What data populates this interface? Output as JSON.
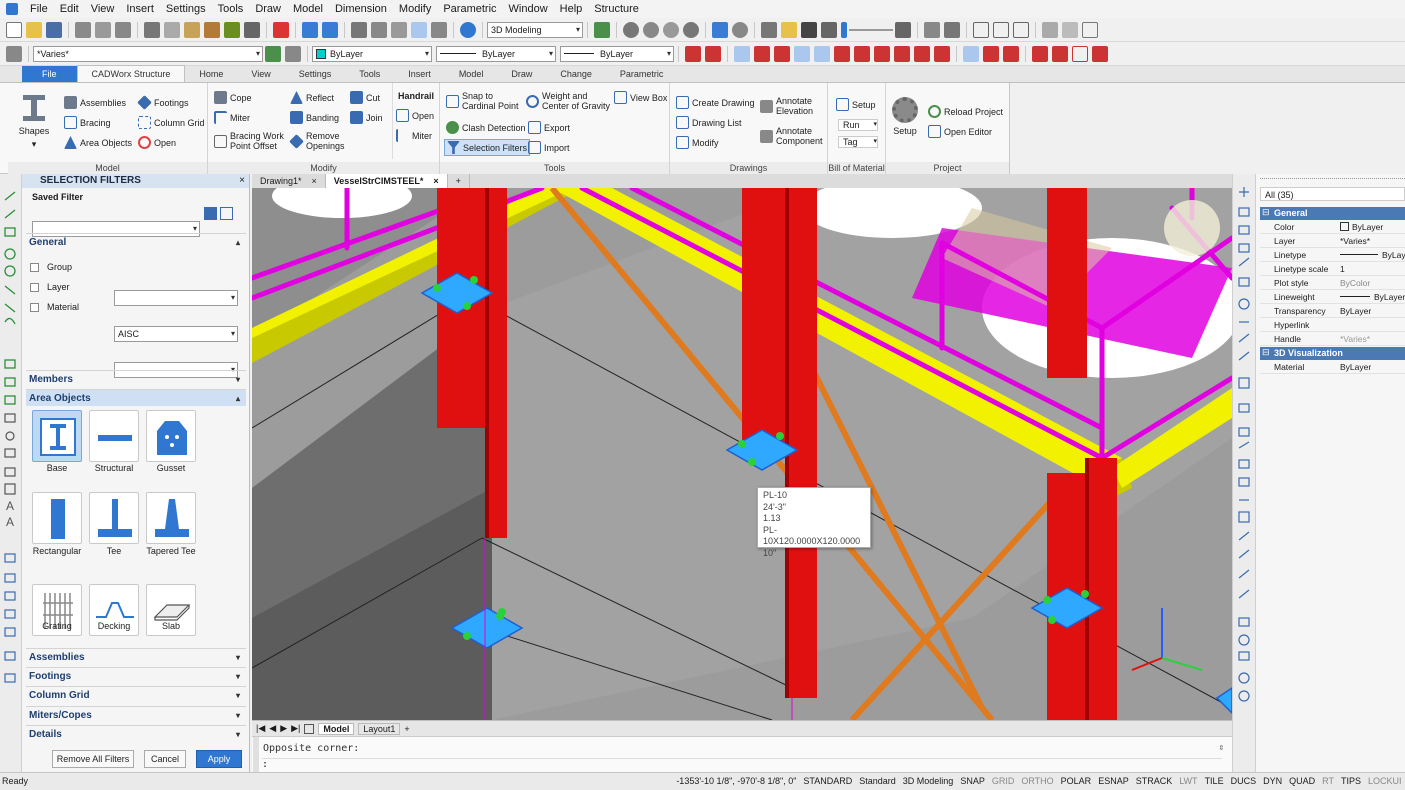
{
  "menu": [
    "File",
    "Edit",
    "View",
    "Insert",
    "Settings",
    "Tools",
    "Draw",
    "Model",
    "Dimension",
    "Modify",
    "Parametric",
    "Window",
    "Help",
    "Structure"
  ],
  "toolbar": {
    "workspace": "3D Modeling",
    "layer_value": "*Varies*",
    "color": "ByLayer",
    "linetype": "ByLayer",
    "lineweight": "ByLayer"
  },
  "ribbon_tabs": [
    "File",
    "CADWorx Structure",
    "Home",
    "View",
    "Settings",
    "Tools",
    "Insert",
    "Model",
    "Draw",
    "Change",
    "Parametric"
  ],
  "ribbon": {
    "model": {
      "label": "Model",
      "shapes": "Shapes",
      "assemblies": "Assemblies",
      "footings": "Footings",
      "bracing": "Bracing",
      "column_grid": "Column Grid",
      "area_objects": "Area Objects",
      "open": "Open"
    },
    "modify": {
      "label": "Modify",
      "cope": "Cope",
      "reflect": "Reflect",
      "cut": "Cut",
      "miter": "Miter",
      "banding": "Banding",
      "join": "Join",
      "bracing_work_point_offset": "Bracing Work Point Offset",
      "remove_openings": "Remove Openings",
      "handrail": "Handrail",
      "handrail_open": "Open",
      "handrail_miter": "Miter"
    },
    "tools": {
      "label": "Tools",
      "snap_cardinal": "Snap to Cardinal Point",
      "weight_cog": "Weight and Center of Gravity",
      "view_box": "View Box",
      "clash_detection": "Clash Detection",
      "export": "Export",
      "selection_filters": "Selection Filters",
      "import": "Import"
    },
    "drawings": {
      "label": "Drawings",
      "create_drawing": "Create Drawing",
      "annotate_elevation": "Annotate Elevation",
      "drawing_list": "Drawing List",
      "modify": "Modify",
      "annotate_component": "Annotate Component"
    },
    "bom": {
      "label": "Bill of Material",
      "setup": "Setup",
      "run": "Run",
      "tag": "Tag"
    },
    "project": {
      "label": "Project",
      "setup": "Setup",
      "reload_project": "Reload Project",
      "open_editor": "Open Editor"
    }
  },
  "selection_filters": {
    "title": "SELECTION FILTERS",
    "saved_filter_label": "Saved Filter",
    "general": "General",
    "fields": [
      {
        "label": "Group",
        "value": ""
      },
      {
        "label": "Layer",
        "value": "AISC"
      },
      {
        "label": "Material",
        "value": ""
      }
    ],
    "members": "Members",
    "area_objects": "Area Objects",
    "tiles": [
      "Base",
      "Structural",
      "Gusset",
      "Rectangular",
      "Tee",
      "Tapered Tee",
      "Grating",
      "Decking",
      "Slab"
    ],
    "assemblies": "Assemblies",
    "footings": "Footings",
    "column_grid": "Column Grid",
    "miters_copes": "Miters/Copes",
    "details": "Details",
    "remove_all": "Remove All Filters",
    "cancel": "Cancel",
    "apply": "Apply"
  },
  "doc_tabs": [
    "Drawing1*",
    "VesselStrCIMSTEEL*"
  ],
  "tooltip": [
    "PL-10",
    "24'-3\"",
    "1.13",
    "PL-10X120.0000X120.0000",
    "10\""
  ],
  "layout_tabs": [
    "Model",
    "Layout1"
  ],
  "command": {
    "history": "Opposite corner:",
    "prompt": ":"
  },
  "properties": {
    "header": "All (35)",
    "general": "General",
    "rows": [
      {
        "key": "Color",
        "value": "ByLayer"
      },
      {
        "key": "Layer",
        "value": "*Varies*"
      },
      {
        "key": "Linetype",
        "value": "ByLayer"
      },
      {
        "key": "Linetype scale",
        "value": "1"
      },
      {
        "key": "Plot style",
        "value": "ByColor"
      },
      {
        "key": "Lineweight",
        "value": "ByLayer"
      },
      {
        "key": "Transparency",
        "value": "ByLayer"
      },
      {
        "key": "Hyperlink",
        "value": ""
      },
      {
        "key": "Handle",
        "value": "*Varies*"
      }
    ],
    "viz": "3D Visualization",
    "viz_rows": [
      {
        "key": "Material",
        "value": "ByLayer"
      }
    ]
  },
  "status": {
    "ready": "Ready",
    "coords": "-1353'-10 1/8\", -970'-8 1/8\", 0\"",
    "items": [
      "STANDARD",
      "Standard",
      "3D Modeling",
      "SNAP",
      "GRID",
      "ORTHO",
      "POLAR",
      "ESNAP",
      "STRACK",
      "LWT",
      "TILE",
      "DUCS",
      "DYN",
      "QUAD",
      "RT",
      "TIPS",
      "LOCKUI"
    ]
  },
  "colors": {
    "accent": "#2f77d0",
    "steel_red": "#e01010",
    "handrail_magenta": "#e000e0",
    "grating_yellow": "#f2f200",
    "brace_orange": "#e07a1e",
    "base_plate_blue": "#1f7fff"
  }
}
